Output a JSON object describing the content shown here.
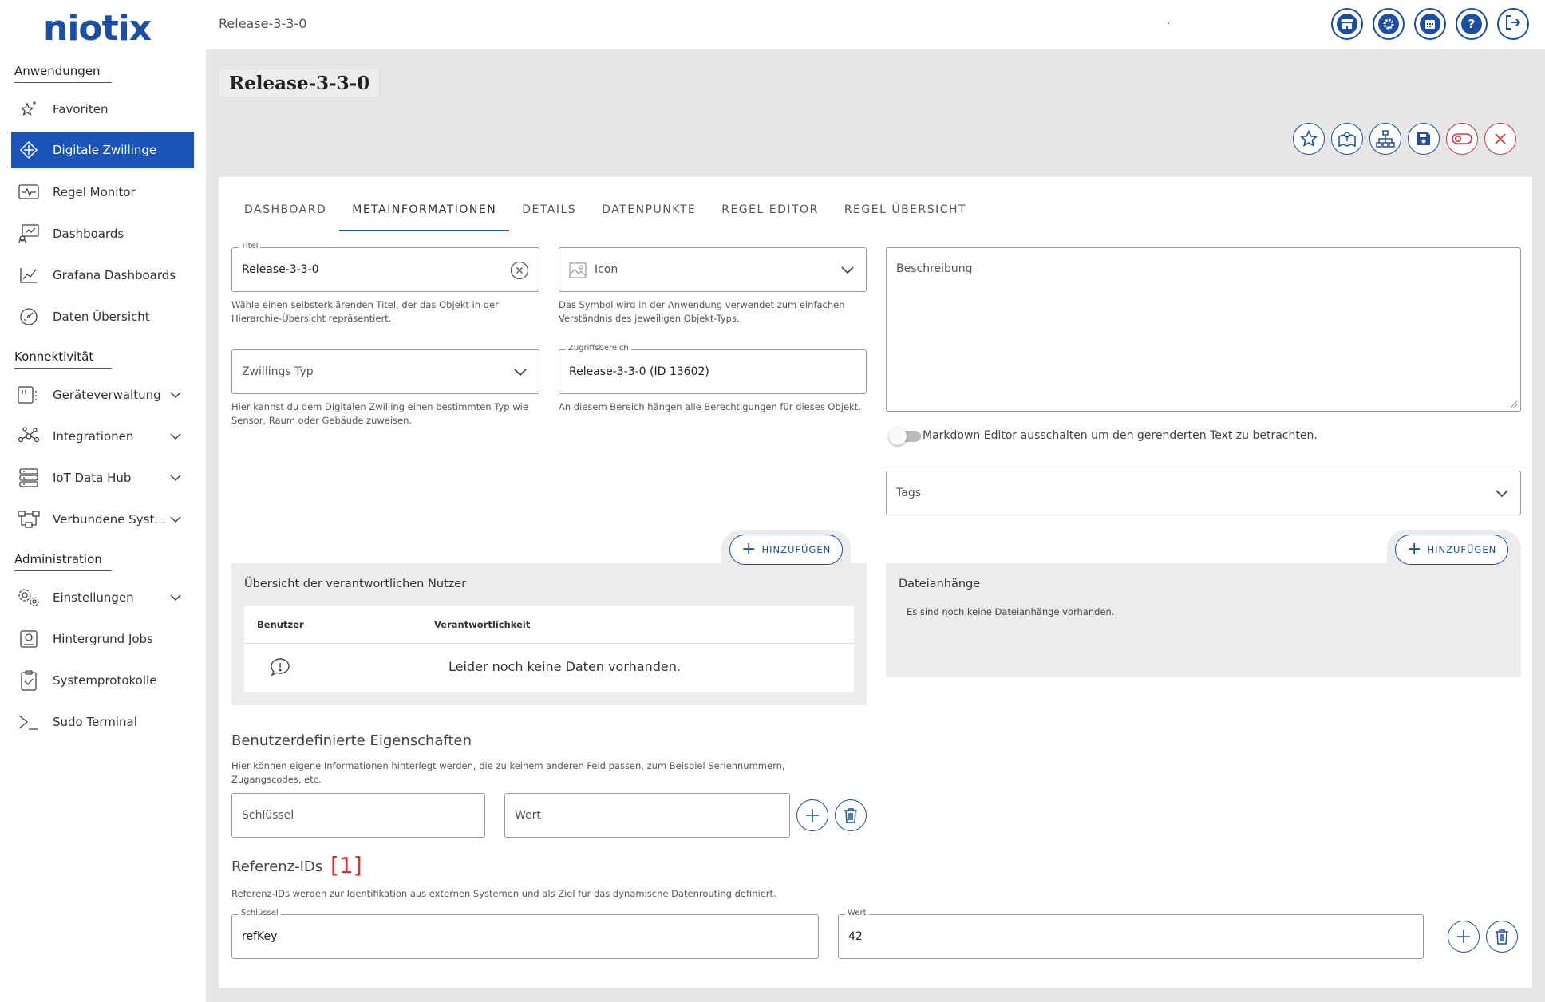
{
  "brand": {
    "logo_text": "niotix",
    "accent": "#1c4fa3",
    "active_bg": "#1c55b8",
    "danger": "#e0303e"
  },
  "sidebar": {
    "sections": [
      {
        "label": "Anwendungen"
      },
      {
        "label": "Konnektivität"
      },
      {
        "label": "Administration"
      }
    ],
    "items": [
      {
        "label": "Favoriten",
        "icon": "star-sparkle-icon"
      },
      {
        "label": "Digitale Zwillinge",
        "icon": "diamond-compass-icon",
        "active": true
      },
      {
        "label": "Regel Monitor",
        "icon": "pulse-monitor-icon"
      },
      {
        "label": "Dashboards",
        "icon": "dashboard-chart-icon"
      },
      {
        "label": "Grafana Dashboards",
        "icon": "line-chart-icon"
      },
      {
        "label": "Daten Übersicht",
        "icon": "gauge-icon"
      },
      {
        "label": "Geräteverwaltung",
        "icon": "device-icon",
        "expandable": true
      },
      {
        "label": "Integrationen",
        "icon": "network-nodes-icon",
        "expandable": true
      },
      {
        "label": "IoT Data Hub",
        "icon": "server-stack-icon",
        "expandable": true
      },
      {
        "label": "Verbundene Syst...",
        "icon": "connected-systems-icon",
        "expandable": true
      },
      {
        "label": "Einstellungen",
        "icon": "gears-icon",
        "expandable": true
      },
      {
        "label": "Hintergrund Jobs",
        "icon": "jobs-icon"
      },
      {
        "label": "Systemprotokolle",
        "icon": "clipboard-check-icon"
      },
      {
        "label": "Sudo Terminal",
        "icon": "terminal-icon"
      }
    ]
  },
  "topbar": {
    "breadcrumb": "Release-3-3-0",
    "dot": ".",
    "buttons": [
      "store-icon",
      "settings-icon",
      "calendar-icon",
      "help-icon",
      "logout-icon"
    ]
  },
  "page": {
    "title": "Release-3-3-0",
    "actions": [
      "favorite-star-icon",
      "map-icon",
      "hierarchy-icon",
      "save-icon",
      "toggle-off-icon",
      "close-icon"
    ]
  },
  "tabs": [
    {
      "label": "DASHBOARD"
    },
    {
      "label": "METAINFORMATIONEN",
      "active": true
    },
    {
      "label": "DETAILS"
    },
    {
      "label": "DATENPUNKTE"
    },
    {
      "label": "REGEL EDITOR"
    },
    {
      "label": "REGEL ÜBERSICHT"
    }
  ],
  "form": {
    "title": {
      "label": "Titel",
      "value": "Release-3-3-0",
      "help": "Wähle einen selbsterklärenden Titel, der das Objekt in der Hierarchie-Übersicht repräsentiert."
    },
    "icon": {
      "placeholder": "Icon",
      "help": "Das Symbol wird in der Anwendung verwendet zum einfachen Verständnis des jeweiligen Objekt-Typs."
    },
    "twin_type": {
      "placeholder": "Zwillings Typ",
      "help": "Hier kannst du dem Digitalen Zwilling einen bestimmten Typ wie Sensor, Raum oder Gebäude zuweisen."
    },
    "access": {
      "label": "Zugriffsbereich",
      "value": "Release-3-3-0 (ID 13602)",
      "help": "An diesem Bereich hängen alle Berechtigungen für dieses Objekt."
    },
    "description": {
      "placeholder": "Beschreibung"
    },
    "markdown_toggle": "Markdown Editor ausschalten um den gerenderten Text zu betrachten.",
    "tags": {
      "placeholder": "Tags"
    }
  },
  "users_panel": {
    "add_label": "HINZUFÜGEN",
    "title": "Übersicht der verantwortlichen Nutzer",
    "columns": [
      "Benutzer",
      "Verantwortlichkeit"
    ],
    "empty": "Leider noch keine Daten vorhanden."
  },
  "files_panel": {
    "add_label": "HINZUFÜGEN",
    "title": "Dateianhänge",
    "empty": "Es sind noch keine Dateianhänge vorhanden."
  },
  "custom_props": {
    "heading": "Benutzerdefinierte Eigenschaften",
    "help": "Hier können eigene Informationen hinterlegt werden, die zu keinem anderen Feld passen, zum Beispiel Seriennummern, Zugangscodes, etc.",
    "key_placeholder": "Schlüssel",
    "value_placeholder": "Wert"
  },
  "ref_ids": {
    "heading": "Referenz-IDs",
    "count": "[1]",
    "help": "Referenz-IDs werden zur Identifikation aus externen Systemen und als Ziel für das dynamische Datenrouting definiert.",
    "key_label": "Schlüssel",
    "key_value": "refKey",
    "value_label": "Wert",
    "value_value": "42"
  }
}
